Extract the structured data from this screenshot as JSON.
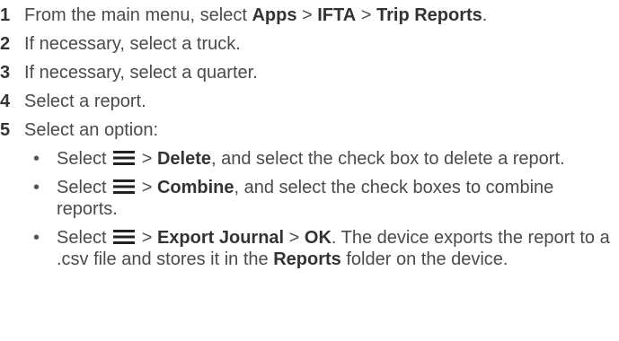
{
  "steps": [
    {
      "num": "1",
      "pre": "From the main menu, select ",
      "b1": "Apps",
      "sep1": " > ",
      "b2": "IFTA",
      "sep2": " > ",
      "b3": "Trip Reports",
      "post": "."
    },
    {
      "num": "2",
      "text": "If necessary, select a truck."
    },
    {
      "num": "3",
      "text": "If necessary, select a quarter."
    },
    {
      "num": "4",
      "text": "Select a report."
    },
    {
      "num": "5",
      "text": "Select an option:"
    }
  ],
  "options": [
    {
      "bullet": "•",
      "pre": "Select",
      "icon": "menu-icon",
      "sep": " > ",
      "b1": "Delete",
      "post": ", and select the check box to delete a report."
    },
    {
      "bullet": "•",
      "pre": "Select",
      "icon": "menu-icon",
      "sep": " > ",
      "b1": "Combine",
      "post": ", and select the check boxes to combine reports."
    },
    {
      "bullet": "•",
      "pre": "Select",
      "icon": "menu-icon",
      "sep1": " > ",
      "b1": "Export Journal",
      "sep2": " > ",
      "b2": "OK",
      "mid": ". The device exports the report to a .csv file and stores it in the ",
      "b3": "Reports",
      "post": " folder on the device."
    }
  ]
}
